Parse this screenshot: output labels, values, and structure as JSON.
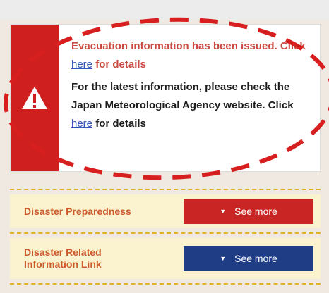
{
  "alert": {
    "evacuation_prefix": "Evacuation information has been issued. Click ",
    "evacuation_link": "here",
    "evacuation_suffix": " for details",
    "latest_prefix": "For the latest information, please check the Japan Meteorological Agency website. Click ",
    "latest_link": "here",
    "latest_suffix": " for details",
    "accent_color": "#cf1f1f",
    "icon": "warning-icon"
  },
  "sections": [
    {
      "label": "Disaster Preparedness",
      "button_label": "See more",
      "button_color": "#c92525",
      "bullet": "▼"
    },
    {
      "label": "Disaster Related Information Link",
      "button_label": "See more",
      "button_color": "#1f3d85",
      "bullet": "▼"
    }
  ],
  "annotation": {
    "shape": "dashed-oval",
    "color": "#d81f1f"
  }
}
